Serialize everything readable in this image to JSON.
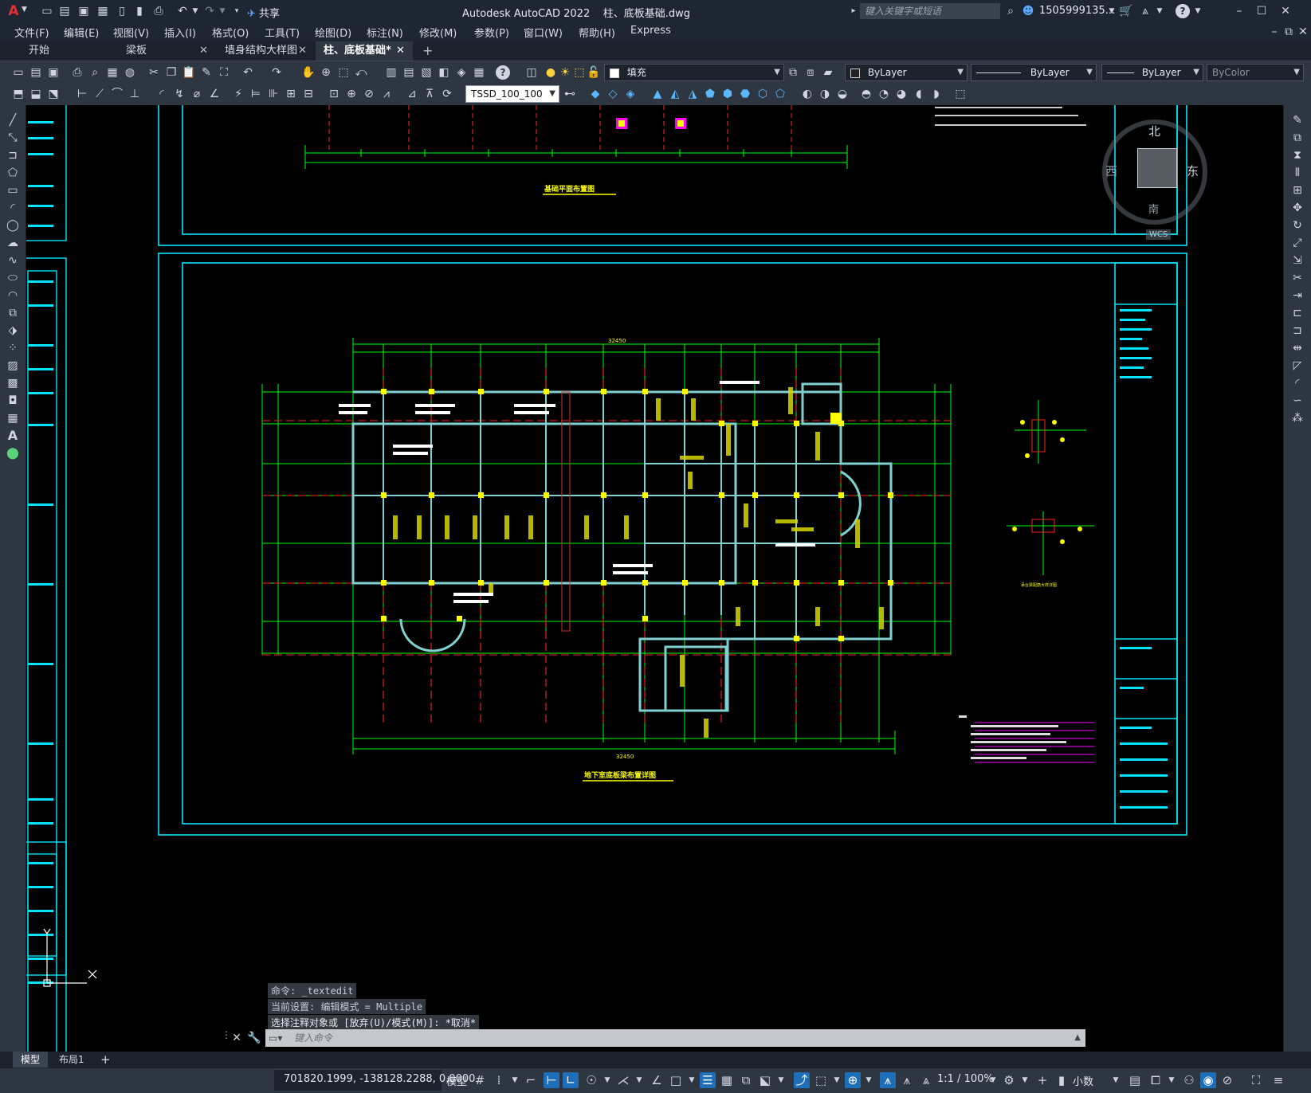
{
  "app": {
    "title": "Autodesk AutoCAD 2022",
    "filename": "柱、底板基础.dwg",
    "share_label": "共享",
    "search_placeholder": "键入关键字或短语",
    "user": "1505999135...",
    "brand_color": "#d42b2b"
  },
  "menu": [
    "文件(F)",
    "编辑(E)",
    "视图(V)",
    "插入(I)",
    "格式(O)",
    "工具(T)",
    "绘图(D)",
    "标注(N)",
    "修改(M)",
    "参数(P)",
    "窗口(W)",
    "帮助(H)",
    "Express"
  ],
  "doc_tabs": [
    {
      "label": "开始"
    },
    {
      "label": "梁板"
    },
    {
      "label": "墙身结构大样图"
    },
    {
      "label": "柱、底板基础*",
      "active": true
    }
  ],
  "toolbar": {
    "layer_name": "填充",
    "color": "ByLayer",
    "linetype": "ByLayer",
    "lineweight": "ByLayer",
    "plotstyle": "ByColor",
    "dimstyle": "TSSD_100_100"
  },
  "navcube": {
    "north": "北",
    "south": "南",
    "east": "东",
    "west": "西",
    "wcs": "WCS"
  },
  "drawing": {
    "title_top": "基础平面布置图",
    "title_main": "地下室底板梁布置详图",
    "title_detail": "承台梁配筋大样详图",
    "dim_total": "32450",
    "colors": {
      "grid": "#00ff00",
      "axis": "#ff2020",
      "frame": "#00e5ff",
      "column": "#ffff00",
      "note": "#ff00ff",
      "beam": "#7fd0d0"
    }
  },
  "commands": {
    "line1": "命令: _textedit",
    "line2": "当前设置: 编辑模式 = Multiple",
    "line3": "选择注释对象或 [放弃(U)/模式(M)]: *取消*",
    "input_placeholder": "键入命令"
  },
  "layout_tabs": [
    "模型",
    "布局1"
  ],
  "status": {
    "coords": "701820.1999, -138128.2288, 0.0000",
    "space": "模型",
    "scale": "1:1 / 100%",
    "units": "小数"
  }
}
